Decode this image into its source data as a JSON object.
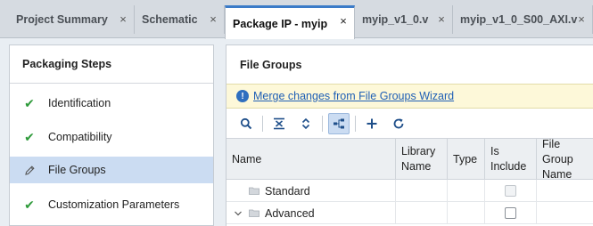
{
  "tabs": [
    {
      "label": "Project Summary",
      "active": false
    },
    {
      "label": "Schematic",
      "active": false
    },
    {
      "label": "Package IP - myip",
      "active": true
    },
    {
      "label": "myip_v1_0.v",
      "active": false
    },
    {
      "label": "myip_v1_0_S00_AXI.v",
      "active": false
    }
  ],
  "close_glyph": "×",
  "packaging": {
    "title": "Packaging Steps",
    "steps": [
      {
        "label": "Identification",
        "status": "check"
      },
      {
        "label": "Compatibility",
        "status": "check"
      },
      {
        "label": "File Groups",
        "status": "edit",
        "selected": true
      },
      {
        "label": "Customization Parameters",
        "status": "check"
      }
    ],
    "check_glyph": "✔"
  },
  "file_groups": {
    "title": "File Groups",
    "info_link": "Merge changes from File Groups Wizard",
    "info_glyph": "!",
    "toolbar": [
      "search-icon",
      "collapse-all-icon",
      "expand-all-icon",
      "hierarchy-icon",
      "add-icon",
      "refresh-icon"
    ],
    "columns": [
      "Name",
      "Library Name",
      "Type",
      "Is Include",
      "File Group Name"
    ],
    "rows": [
      {
        "name": "Standard",
        "expandable": false,
        "is_include_enabled": false
      },
      {
        "name": "Advanced",
        "expandable": true,
        "expanded_glyph": "⌄",
        "is_include_enabled": true
      }
    ]
  },
  "colors": {
    "accent": "#3b7bc8",
    "selected_bg": "#cbdcf2",
    "check_green": "#2e9a3a",
    "link": "#1f5fb5",
    "info_bg": "#fdf8d9"
  }
}
